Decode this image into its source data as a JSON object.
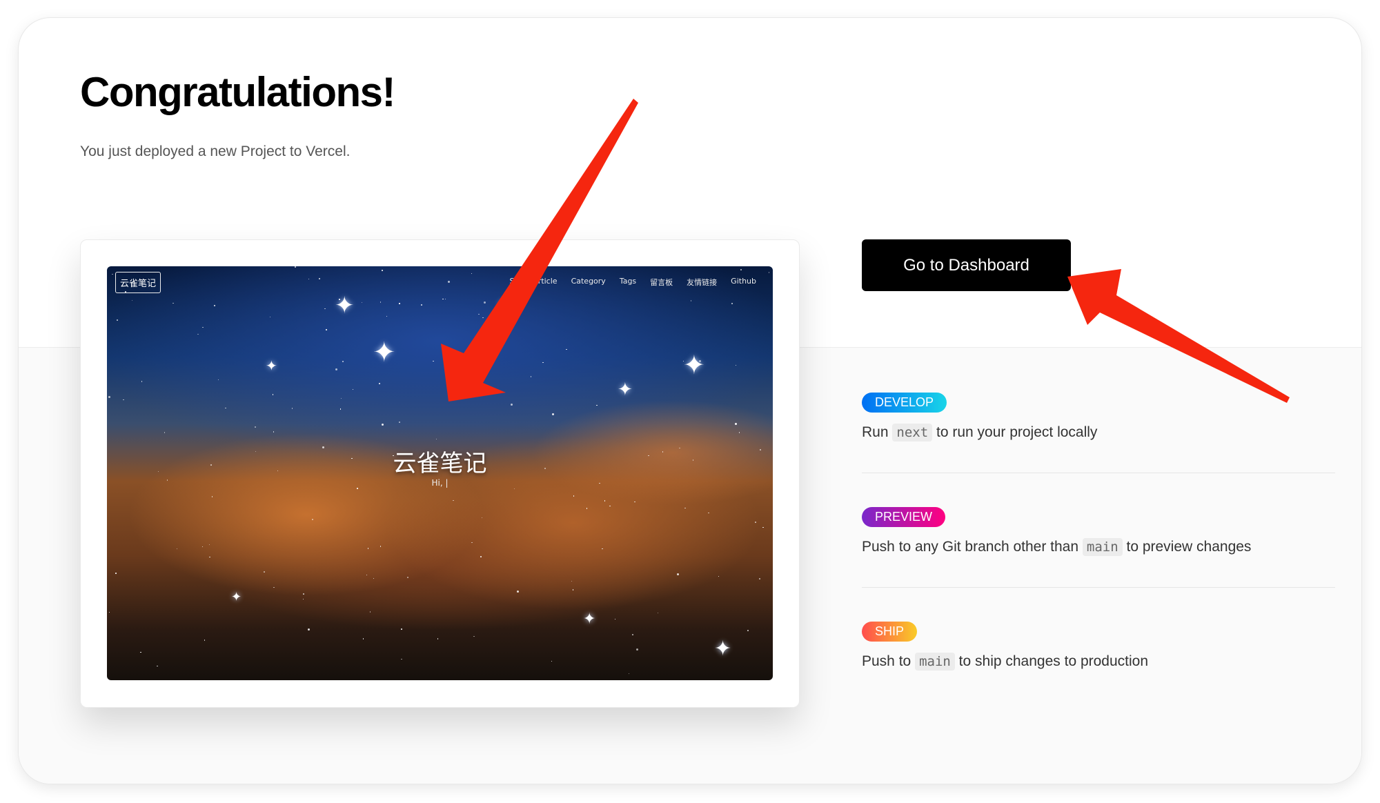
{
  "page": {
    "title": "Congratulations!",
    "subtitle": "You just deployed a new Project to Vercel."
  },
  "preview_site": {
    "logo": "云雀笔记",
    "nav": [
      "Se",
      "Article",
      "Category",
      "Tags",
      "留言板",
      "友情链接",
      "Github"
    ],
    "hero_title": "云雀笔记",
    "hero_subtitle": "Hi, |"
  },
  "dashboard_button": {
    "label": "Go to Dashboard"
  },
  "steps": [
    {
      "badge": "DEVELOP",
      "text_before": "Run",
      "code": "next",
      "text_after": "to run your project locally"
    },
    {
      "badge": "PREVIEW",
      "text_before": "Push to any Git branch other than",
      "code": "main",
      "text_after": "to preview changes"
    },
    {
      "badge": "SHIP",
      "text_before": "Push to",
      "code": "main",
      "text_after": "to ship changes to production"
    }
  ],
  "colors": {
    "annotation_arrow": "#f5260f",
    "button_bg": "#000000",
    "develop_gradient": [
      "#0070f3",
      "#19d4e8"
    ],
    "preview_gradient": [
      "#7928ca",
      "#ff0080"
    ],
    "ship_gradient": [
      "#ff4d4d",
      "#f9cb28"
    ]
  }
}
